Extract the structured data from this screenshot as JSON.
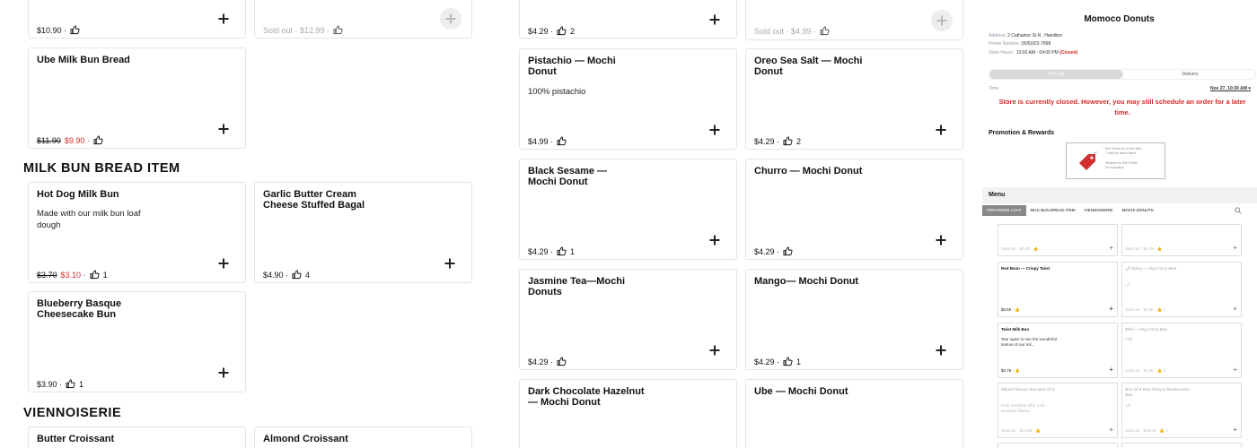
{
  "sections": {
    "milk_bun": "MILK BUN BREAD ITEM",
    "viennoiserie": "VIENNOISERIE"
  },
  "products": {
    "p1": {
      "price": "$10.90 ·"
    },
    "p2": {
      "price": "Sold out · $12.99 ·"
    },
    "p3": {
      "name": "Ube Milk Bun Bread",
      "orig": "$11.90",
      "sale": "$9.90 ·"
    },
    "p4": {
      "name": "Hot Dog Milk Bun",
      "desc": "Made with our milk bun loaf dough",
      "orig": "$3.70",
      "sale": "$3.10 ·",
      "likes": "1"
    },
    "p5": {
      "name": "Garlic Butter Cream Cheese Stuffed Bagal",
      "price": "$4.90 ·",
      "likes": "4"
    },
    "p6": {
      "name": "Blueberry Basque Cheesecake Bun",
      "price": "$3.90 ·",
      "likes": "1"
    },
    "p7": {
      "name": "Butter Croissant"
    },
    "p8": {
      "name": "Almond Croissant"
    },
    "m0a": {
      "price": "$4.29 ·",
      "likes": "2"
    },
    "m0b": {
      "price": "Sold out · $4.99 ·"
    },
    "m1": {
      "name": "Pistachio — Mochi Donut",
      "desc": "100% pistachio",
      "price": "$4.99 ·"
    },
    "m2": {
      "name": "Oreo Sea Salt — Mochi Donut",
      "price": "$4.29 ·",
      "likes": "2"
    },
    "m3": {
      "name": "Black Sesame — Mochi Donut",
      "price": "$4.29 ·",
      "likes": "1"
    },
    "m4": {
      "name": "Churro — Mochi Donut",
      "price": "$4.29 ·"
    },
    "m5": {
      "name": "Jasmine Tea—Mochi Donuts",
      "price": "$4.29 ·"
    },
    "m6": {
      "name": "Mango— Mochi Donut",
      "price": "$4.29 ·",
      "likes": "1"
    },
    "m7": {
      "name": "Dark Chocolate Hazelnut — Mochi Donut"
    },
    "m8": {
      "name": "Ube — Mochi Donut"
    }
  },
  "panel": {
    "store": "Momoco Donuts",
    "address_label": "Address:",
    "address": "2 Catharine St N , Hamilton",
    "phone_label": "Phone Number:",
    "phone": "(905)923-7898",
    "hours_label": "Store Hours:",
    "hours": "10:00 AM - 04:00 PM",
    "closed": "(Closed)",
    "pickup": "Pick Up",
    "delivery": "Delivery",
    "time_label": "Time",
    "time_value": "Nov 27, 10:30 AM",
    "closed_msg": "Store is currently closed. However, you may still schedule an order for a later time.",
    "promo_label": "Promotion & Rewards",
    "promo_line1": "$40 Points for a Free Item",
    "promo_line2": "• Valid for select items",
    "promo_line3": "Redeem for $40 Points",
    "promo_line4": "No expiration",
    "menu_label": "Menu",
    "tabs": [
      "PREORDER LOAF",
      "MILK BUN BREAD ITEM",
      "VIENNOISERIE",
      "MOCHI DONUTS"
    ],
    "mini": {
      "a0": {
        "meta": "Sold out · $4.29 ·"
      },
      "b0": {
        "meta": "Sold out · $4.29 ·"
      },
      "a1": {
        "name": "Red Bean — Crispy Twist",
        "meta": "$3.50 ·"
      },
      "b1": {
        "name": "🌶 Spicy — Veg Curry Bun",
        "desc": "🌶",
        "meta": "Sold out · $4.50 ·",
        "likes": "1"
      },
      "a2": {
        "name": "Twist Milk Bun",
        "desc": "Tear apart to see the wonderful texture of our mil...",
        "meta": "$2.75 ·"
      },
      "b2": {
        "name": "Mild — Veg Curry Bun",
        "desc": "mild",
        "meta": "Sold out · $4.50 ·",
        "likes": "1"
      },
      "a3": {
        "name": "Mixed Flavour Bao Box Of 6",
        "desc": "Only available after 1:30... assorted flavour",
        "meta": "Sold out · $14.99 ·"
      },
      "b3": {
        "name": "Box Of 6 Bok Choy & Mushrooms Bao",
        "desc": "1/6",
        "meta": "Sold out · $15.90 ·",
        "likes": "2"
      }
    }
  },
  "colors": {
    "sale_red": "#d62b2b",
    "tab_active": "#888888"
  }
}
